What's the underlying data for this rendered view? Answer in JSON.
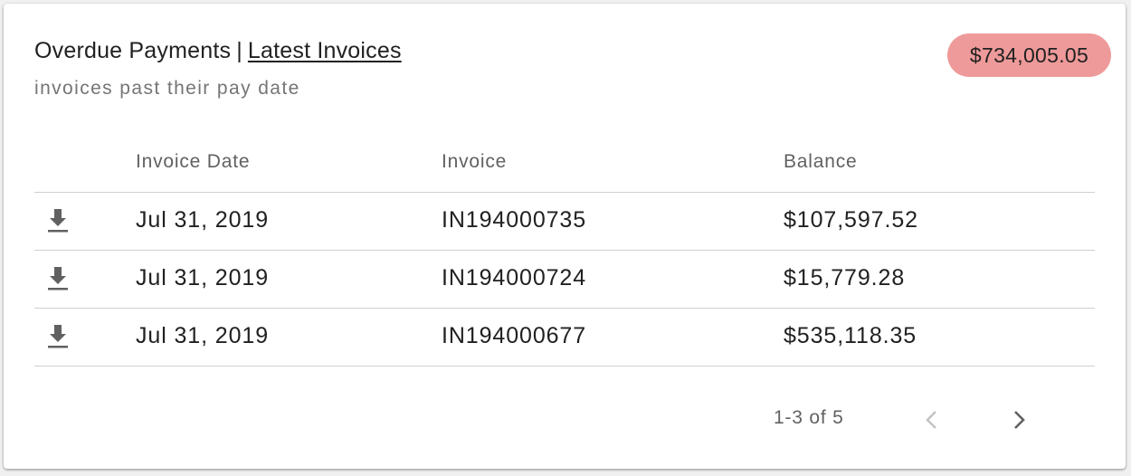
{
  "header": {
    "title": "Overdue Payments",
    "separator": "|",
    "link_label": "Latest Invoices",
    "subtitle": "invoices past their pay date",
    "total_badge": "$734,005.05",
    "badge_color": "#ef9a9a"
  },
  "table": {
    "columns": [
      "Invoice Date",
      "Invoice",
      "Balance"
    ],
    "rows": [
      {
        "icon": "download-icon",
        "date": "Jul 31, 2019",
        "invoice": "IN194000735",
        "balance": "$107,597.52"
      },
      {
        "icon": "download-icon",
        "date": "Jul 31, 2019",
        "invoice": "IN194000724",
        "balance": "$15,779.28"
      },
      {
        "icon": "download-icon",
        "date": "Jul 31, 2019",
        "invoice": "IN194000677",
        "balance": "$535,118.35"
      }
    ]
  },
  "pagination": {
    "range_text": "1-3 of 5",
    "prev_icon": "chevron-left-icon",
    "next_icon": "chevron-right-icon"
  }
}
